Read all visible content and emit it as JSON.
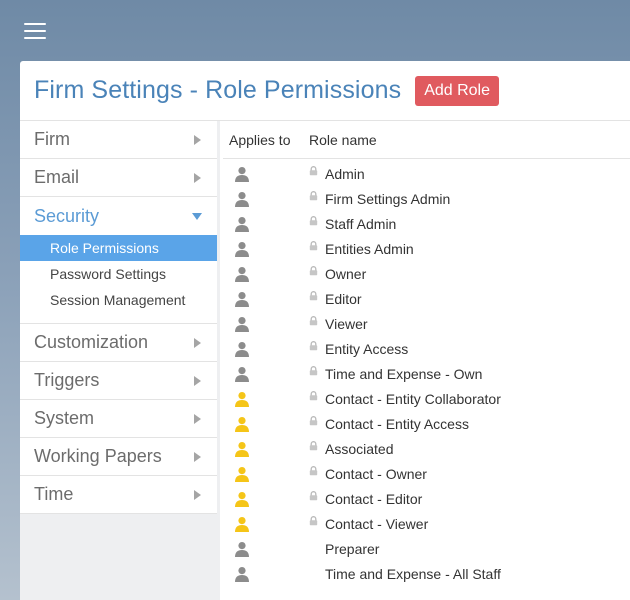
{
  "topbar": {
    "menu_icon": "hamburger-menu-icon"
  },
  "header": {
    "title": "Firm Settings - Role Permissions",
    "add_button": "Add Role"
  },
  "colors": {
    "accent_blue": "#4a83b8",
    "selected_bg": "#5aa4e8",
    "add_button_bg": "#e05a5f",
    "staff_icon": "#8c8c8c",
    "contact_icon": "#f5c518"
  },
  "sidebar": {
    "items": [
      {
        "label": "Firm"
      },
      {
        "label": "Email"
      },
      {
        "label": "Security",
        "expanded": true,
        "sub": [
          {
            "label": "Role Permissions",
            "selected": true
          },
          {
            "label": "Password Settings"
          },
          {
            "label": "Session Management"
          }
        ]
      },
      {
        "label": "Customization"
      },
      {
        "label": "Triggers"
      },
      {
        "label": "System"
      },
      {
        "label": "Working Papers"
      },
      {
        "label": "Time"
      }
    ]
  },
  "table": {
    "col_applies": "Applies to",
    "col_role": "Role name",
    "rows": [
      {
        "name": "Admin",
        "applies": "staff",
        "locked": true
      },
      {
        "name": "Firm Settings Admin",
        "applies": "staff",
        "locked": true
      },
      {
        "name": "Staff Admin",
        "applies": "staff",
        "locked": true
      },
      {
        "name": "Entities Admin",
        "applies": "staff",
        "locked": true
      },
      {
        "name": "Owner",
        "applies": "staff",
        "locked": true
      },
      {
        "name": "Editor",
        "applies": "staff",
        "locked": true
      },
      {
        "name": "Viewer",
        "applies": "staff",
        "locked": true
      },
      {
        "name": "Entity Access",
        "applies": "staff",
        "locked": true
      },
      {
        "name": "Time and Expense - Own",
        "applies": "staff",
        "locked": true
      },
      {
        "name": "Contact - Entity Collaborator",
        "applies": "contact",
        "locked": true
      },
      {
        "name": "Contact - Entity Access",
        "applies": "contact",
        "locked": true
      },
      {
        "name": "Associated",
        "applies": "contact",
        "locked": true
      },
      {
        "name": "Contact - Owner",
        "applies": "contact",
        "locked": true
      },
      {
        "name": "Contact - Editor",
        "applies": "contact",
        "locked": true
      },
      {
        "name": "Contact - Viewer",
        "applies": "contact",
        "locked": true
      },
      {
        "name": "Preparer",
        "applies": "staff",
        "locked": false
      },
      {
        "name": "Time and Expense - All Staff",
        "applies": "staff",
        "locked": false
      }
    ]
  }
}
